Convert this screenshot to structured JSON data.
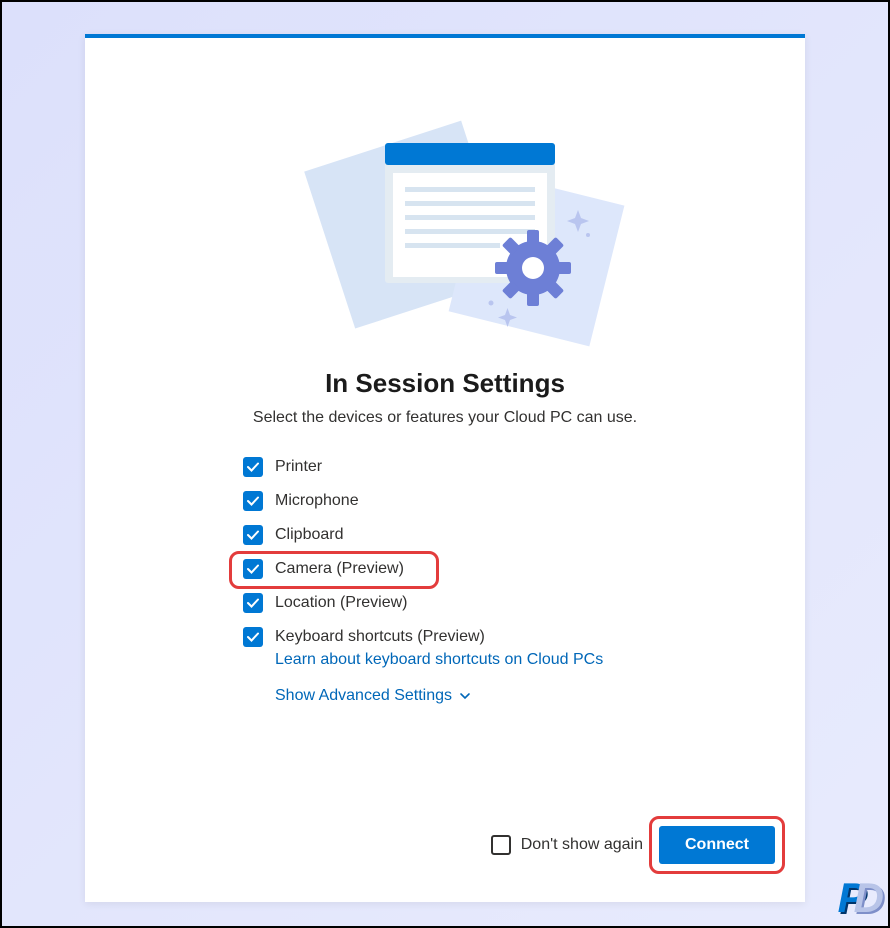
{
  "dialog": {
    "title": "In Session Settings",
    "subtitle": "Select the devices or features your Cloud PC can use.",
    "options": [
      {
        "label": "Printer",
        "checked": true
      },
      {
        "label": "Microphone",
        "checked": true
      },
      {
        "label": "Clipboard",
        "checked": true
      },
      {
        "label": "Camera (Preview)",
        "checked": true,
        "highlighted": true
      },
      {
        "label": "Location (Preview)",
        "checked": true
      },
      {
        "label": "Keyboard shortcuts (Preview)",
        "checked": true,
        "sublink": "Learn about keyboard shortcuts on Cloud PCs"
      }
    ],
    "advanced_link": "Show Advanced Settings",
    "dont_show_label": "Don't show again",
    "dont_show_checked": false,
    "connect_label": "Connect"
  },
  "colors": {
    "primary": "#0078d4",
    "link": "#0067b8",
    "highlight": "#e33c3c"
  }
}
